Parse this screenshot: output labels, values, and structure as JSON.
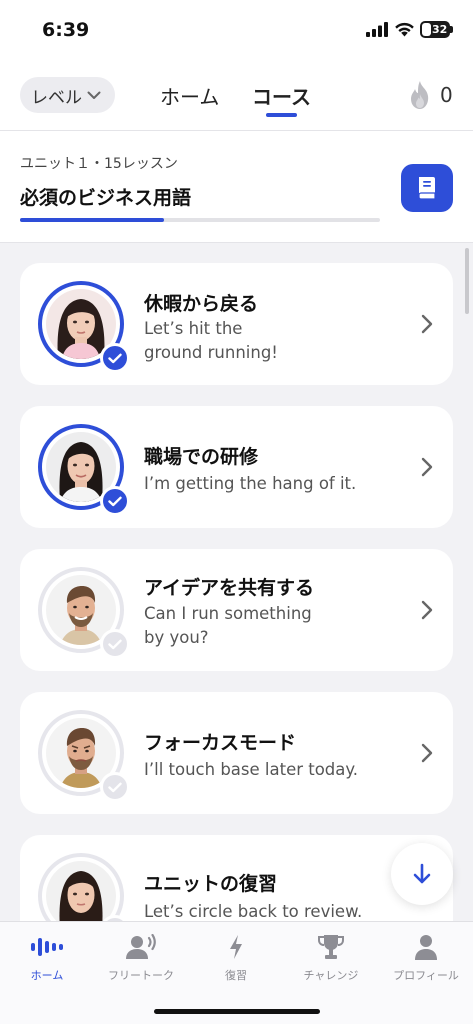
{
  "status_bar": {
    "time": "6:39",
    "battery": "32"
  },
  "header": {
    "level_label": "レベル",
    "tabs": [
      {
        "label": "ホーム",
        "active": false
      },
      {
        "label": "コース",
        "active": true
      }
    ],
    "streak_count": "0"
  },
  "unit": {
    "subtitle": "ユニット１・15レッスン",
    "title": "必須のビジネス用語",
    "progress_fraction": 0.4
  },
  "lessons": [
    {
      "title": "休暇から戻る",
      "phrase_line1": "Let’s hit the",
      "phrase_line2": "ground running!",
      "completed": true
    },
    {
      "title": "職場での研修",
      "phrase_line1": "I’m getting the hang of it.",
      "phrase_line2": "",
      "completed": true
    },
    {
      "title": "アイデアを共有する",
      "phrase_line1": "Can I run something",
      "phrase_line2": "by you?",
      "completed": false
    },
    {
      "title": "フォーカスモード",
      "phrase_line1": "I’ll touch base later today.",
      "phrase_line2": "",
      "completed": false
    },
    {
      "title": "ユニットの復習",
      "phrase_line1": "Let’s circle back to review.",
      "phrase_line2": "",
      "completed": false
    }
  ],
  "bottom_nav": [
    {
      "label": "ホーム",
      "icon": "voice-wave-icon",
      "active": true
    },
    {
      "label": "フリートーク",
      "icon": "speaking-person-icon",
      "active": false
    },
    {
      "label": "復習",
      "icon": "lightning-icon",
      "active": false
    },
    {
      "label": "チャレンジ",
      "icon": "trophy-icon",
      "active": false
    },
    {
      "label": "プロフィール",
      "icon": "person-icon",
      "active": false
    }
  ],
  "colors": {
    "accent": "#2e4ed8",
    "background": "#f2f2f5",
    "card": "#ffffff"
  }
}
